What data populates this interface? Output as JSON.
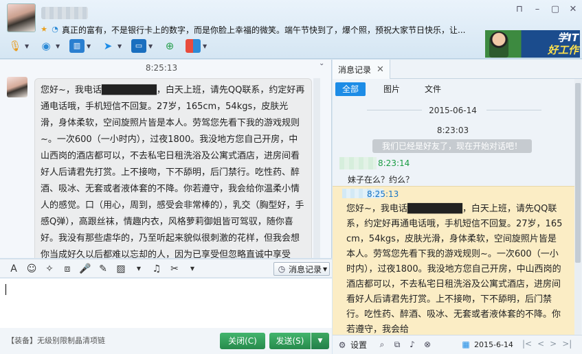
{
  "header": {
    "contact_name": "",
    "signature": "真正的富有，不是银行卡上的数字，而是你脸上幸福的微笑。端午节快到了，爆个照，预祝大家节日快乐，让...",
    "ad": {
      "line1": "学IT",
      "line2": "好工作"
    },
    "toolbar_icons": [
      "microphone-icon",
      "webcam-icon",
      "screen-share-icon",
      "file-transfer-icon",
      "remote-assist-icon",
      "add-contact-icon",
      "apps-icon"
    ]
  },
  "window": {
    "controls": [
      "gift-icon",
      "minimize-icon",
      "maximize-icon",
      "close-icon"
    ]
  },
  "conversation": {
    "timestamp": "8:25:13",
    "message": "您好~，我电话████████，白天上班，请先QQ联系，约定好再通电话哦，手机短信不回复。27岁，165cm，54kgs，皮肤光滑，身体柔软，空间旋照片皆是本人。劳驾您先看下我的游戏规则~。一次600（一小时内），过夜1800。我没地方您自己开房，中山西岗的酒店都可以，不去私宅日租洗浴及公寓式酒店，进房间看好人后请君先打赏。上不接吻，下不舔明，后门禁行。吃性药、醉酒、吸冰、无套或者液体套的不降。你若遵守，我会给你温柔小情人的感觉。口（用心，周到，感受会非常棒的），乳交（胸型好，手感Q弹），高跟丝袜，情趣内衣，风格萝莉御姐皆可驾驭，随你喜好。我没有那些虐华的，乃至听起来貌似很刺激的花样，但我会想你当成好久以后都难以忘却的人，因为已享受但忽略直诚中享受"
  },
  "input": {
    "history_button": "消息记录",
    "equip_label": "【装备】无级别限制晶清项链",
    "close_button": "关闭(C)",
    "send_button": "发送(S)"
  },
  "history": {
    "tab_label": "消息记录",
    "filters": [
      "全部",
      "图片",
      "文件"
    ],
    "date": "2015-06-14",
    "time1": "8:23:03",
    "system_note": "我们已经是好友了，现在开始对话吧！",
    "time2": "8:23:14",
    "msg1": "妹子在么？约么？",
    "time3": "8:25:13",
    "msg2": "您好~，我电话████████，白天上班，请先QQ联系，约定好再通电话哦，手机短信不回复。27岁，165cm，54kgs，皮肤光滑，身体柔软，空间旋照片皆是本人。劳驾您先看下我的游戏规则~。一次600（一小时内），过夜1800。我没地方您自己开房，中山西岗的酒店都可以，不去私宅日租洗浴及公寓式酒店，进房间看好人后请君先打赏。上不接吻，下不舔明，后门禁行。吃性药、醉酒、吸冰、无套或者液体套的不降。你若遵守，我会给"
  },
  "history_footer": {
    "settings_label": "设置",
    "date_value": "2015-6-14",
    "nav": [
      "|<",
      "<",
      ">",
      ">|"
    ]
  },
  "colors": {
    "accent": "#1d8ce6",
    "send_green": "#2f9b57",
    "history_bubble": "#fbedc5",
    "chat_bg": "#f4f7fb"
  }
}
